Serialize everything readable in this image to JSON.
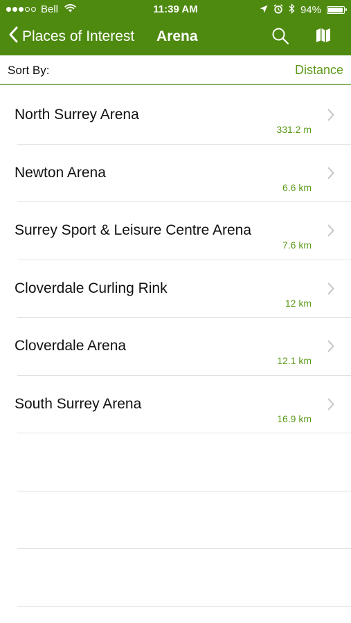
{
  "status_bar": {
    "carrier": "Bell",
    "time": "11:39 AM",
    "battery_percent": "94%",
    "battery_level": 0.94,
    "signal_bars_filled": 3,
    "signal_bars_total": 5,
    "icons": [
      "wifi-icon",
      "location-arrow-icon",
      "alarm-icon",
      "bluetooth-icon",
      "battery-icon"
    ]
  },
  "nav": {
    "back_label": "Places of Interest",
    "title": "Arena",
    "icons": [
      "chevron-left-icon",
      "search-icon",
      "map-icon"
    ]
  },
  "sort": {
    "label": "Sort By:",
    "value": "Distance"
  },
  "colors": {
    "header": "#4e8a10",
    "accent": "#5d9a1b",
    "separator": "#e2e2e2",
    "sort_underline": "#8ab565"
  },
  "places": [
    {
      "name": "North Surrey Arena",
      "distance": "331.2 m"
    },
    {
      "name": "Newton Arena",
      "distance": "6.6 km"
    },
    {
      "name": "Surrey Sport & Leisure Centre Arena",
      "distance": "7.6 km"
    },
    {
      "name": "Cloverdale Curling Rink",
      "distance": "12 km"
    },
    {
      "name": "Cloverdale Arena",
      "distance": "12.1 km"
    },
    {
      "name": "South Surrey Arena",
      "distance": "16.9 km"
    }
  ]
}
